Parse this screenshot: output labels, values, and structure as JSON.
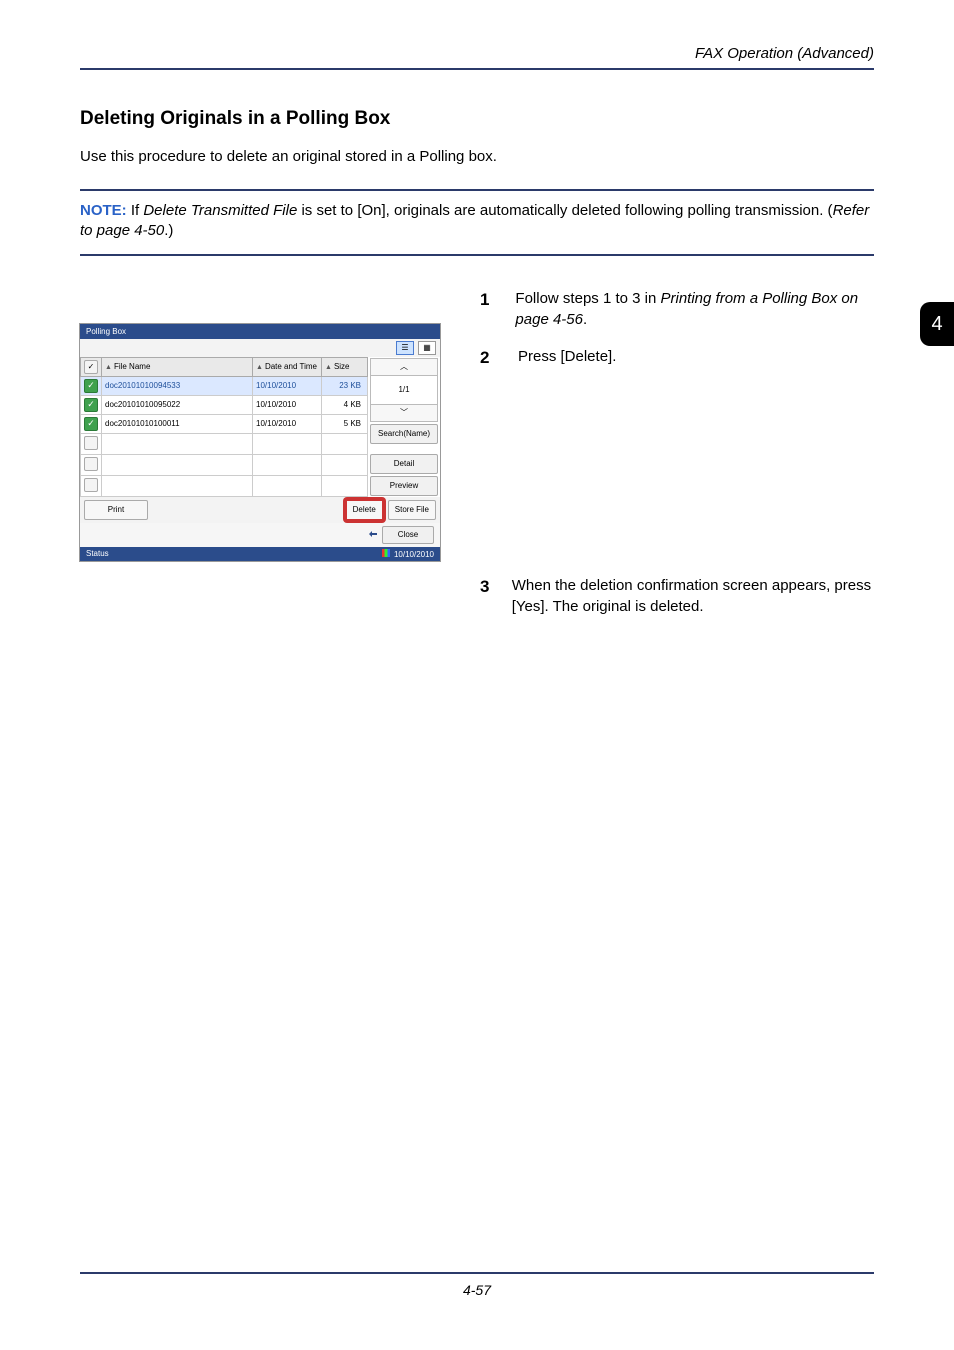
{
  "running_head": "FAX Operation (Advanced)",
  "section_title": "Deleting Originals in a Polling Box",
  "intro": "Use this procedure to delete an original stored in a Polling box.",
  "note": {
    "label": "NOTE:",
    "text_before_em": " If ",
    "em1": "Delete Transmitted File",
    "text_mid": " is set to [On], originals are automatically deleted following polling transmission. (",
    "em2": "Refer to page 4-50",
    "text_after": ".)"
  },
  "steps": [
    {
      "num": "1",
      "pre": "Follow steps 1 to 3 in ",
      "em": "Printing from a Polling Box on page 4-56",
      "post": "."
    },
    {
      "num": "2",
      "pre": "Press [Delete].",
      "em": "",
      "post": ""
    },
    {
      "num": "3",
      "pre": "When the deletion confirmation screen appears, press [Yes]. The original is deleted.",
      "em": "",
      "post": ""
    }
  ],
  "side_tab": "4",
  "page_number": "4-57",
  "ui": {
    "title": "Polling Box",
    "columns": {
      "name": "File Name",
      "date": "Date and Time",
      "size": "Size"
    },
    "rows": [
      {
        "checked": true,
        "selected": true,
        "name": "doc20101010094533",
        "date": "10/10/2010",
        "size": "23 KB"
      },
      {
        "checked": true,
        "selected": false,
        "name": "doc20101010095022",
        "date": "10/10/2010",
        "size": "4 KB"
      },
      {
        "checked": true,
        "selected": false,
        "name": "doc20101010100011",
        "date": "10/10/2010",
        "size": "5 KB"
      },
      {
        "checked": false,
        "selected": false,
        "name": "",
        "date": "",
        "size": ""
      },
      {
        "checked": false,
        "selected": false,
        "name": "",
        "date": "",
        "size": ""
      },
      {
        "checked": false,
        "selected": false,
        "name": "",
        "date": "",
        "size": ""
      }
    ],
    "pager": "1/1",
    "buttons": {
      "search": "Search(Name)",
      "detail": "Detail",
      "preview": "Preview",
      "print": "Print",
      "delete": "Delete",
      "store": "Store File",
      "close": "Close"
    },
    "status_left": "Status",
    "status_right": "10/10/2010"
  }
}
